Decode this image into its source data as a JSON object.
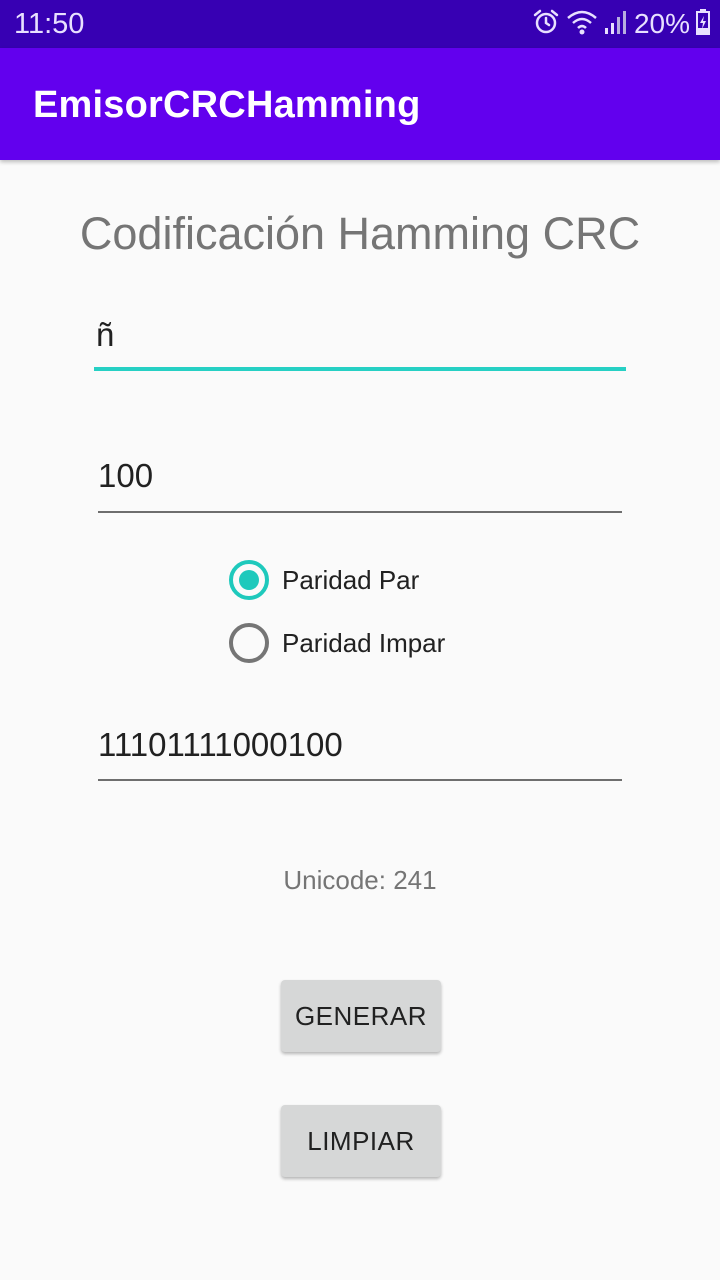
{
  "status_bar": {
    "time": "11:50",
    "battery": "20%",
    "icons": [
      "alarm-icon",
      "wifi-icon",
      "signal-icon",
      "battery-charging-icon"
    ]
  },
  "app_bar": {
    "title": "EmisorCRCHamming"
  },
  "main": {
    "heading": "Codificación Hamming CRC",
    "char_input_value": "ñ",
    "divisor_input_value": "100",
    "parity_options": [
      {
        "label": "Paridad Par",
        "checked": true
      },
      {
        "label": "Paridad Impar",
        "checked": false
      }
    ],
    "result_value": "11101111000100",
    "unicode_text": "Unicode: 241",
    "generate_label": "GENERAR",
    "clear_label": "LIMPIAR"
  },
  "colors": {
    "status_bar": "#3700b3",
    "app_bar": "#6200ee",
    "accent": "#1ec9bc"
  }
}
